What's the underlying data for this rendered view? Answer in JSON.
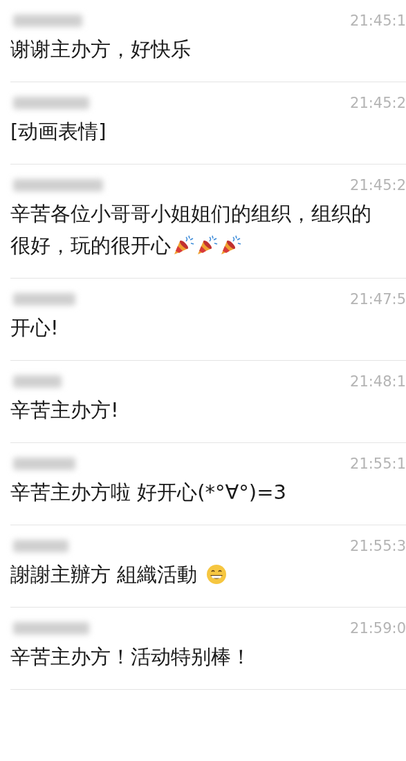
{
  "messages": [
    {
      "time": "21:45:1",
      "lines": [
        "谢谢主办方，好快乐"
      ]
    },
    {
      "time": "21:45:2",
      "lines": [
        "[动画表情]"
      ]
    },
    {
      "time": "21:45:2",
      "lines": [
        "辛苦各位小哥哥小姐姐们的组织，组织的",
        "很好，玩的很开心"
      ],
      "icons": [
        {
          "kind": "party-popper"
        },
        {
          "kind": "party-popper"
        },
        {
          "kind": "party-popper"
        }
      ]
    },
    {
      "time": "21:47:5",
      "lines": [
        "开心!"
      ]
    },
    {
      "time": "21:48:1",
      "lines": [
        "辛苦主办方!"
      ]
    },
    {
      "time": "21:55:1",
      "lines": [
        "辛苦主办方啦 好开心(*°∀°)=3"
      ]
    },
    {
      "time": "21:55:3",
      "lines": [
        "謝謝主辦方 組織活動"
      ],
      "icons": [
        {
          "kind": "grin"
        }
      ]
    },
    {
      "time": "21:59:0",
      "lines": [
        "辛苦主办方！活动特别棒！"
      ]
    }
  ]
}
